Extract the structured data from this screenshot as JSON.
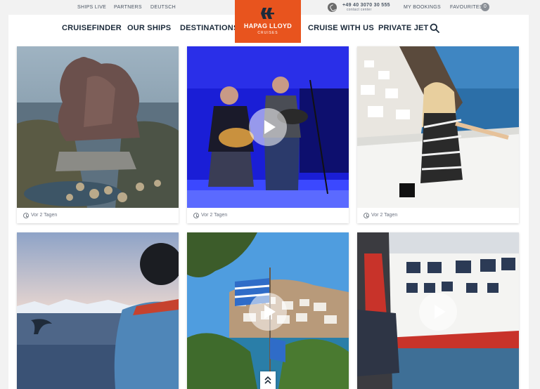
{
  "topbar": {
    "links": [
      "SHIPS LIVE",
      "PARTNERS",
      "DEUTSCH"
    ],
    "phone_number": "+49 40 3070 30 555",
    "phone_sub": "contact center",
    "my_bookings": "MY BOOKINGS",
    "favourites": "FAVOURITES",
    "favourites_count": "0"
  },
  "nav": {
    "left": [
      "CRUISEFINDER",
      "OUR SHIPS",
      "DESTINATIONS"
    ],
    "right": [
      "CRUISE WITH US",
      "PRIVATE JET"
    ],
    "search_icon": "search-icon"
  },
  "logo": {
    "brand": "HAPAG LLOYD",
    "sub": "CRUISES",
    "color": "#e8541e"
  },
  "feed": {
    "posts": [
      {
        "time": "Vor 2 Tagen",
        "type": "image",
        "subject": "statue-on-rocks"
      },
      {
        "time": "Vor 2 Tagen",
        "type": "video",
        "subject": "guitar-concert"
      },
      {
        "time": "Vor 2 Tagen",
        "type": "image",
        "subject": "woman-santorini"
      },
      {
        "time": "",
        "type": "image",
        "subject": "whale-tail"
      },
      {
        "time": "",
        "type": "video",
        "subject": "greek-harbour"
      },
      {
        "time": "",
        "type": "video",
        "subject": "cruise-ship"
      }
    ]
  },
  "accent": "#e8541e"
}
